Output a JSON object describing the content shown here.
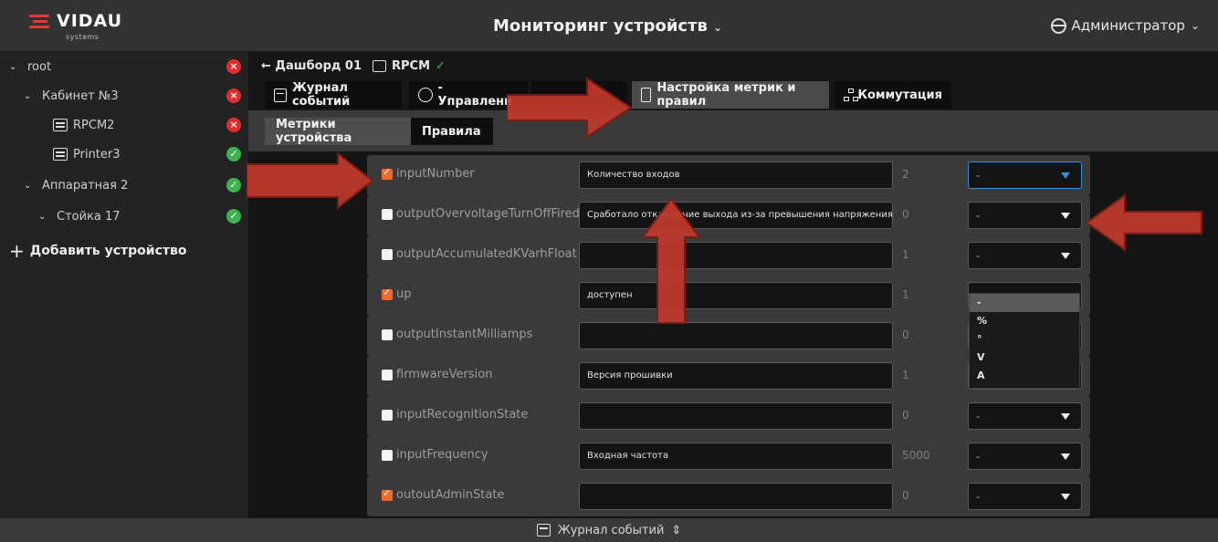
{
  "header": {
    "logo_text": "VIDAU",
    "logo_sub": "systems",
    "title": "Мониторинг устройств",
    "user": "Администратор"
  },
  "sidebar": {
    "items": [
      {
        "label": "root",
        "status": "error"
      },
      {
        "label": "Кабинет №3",
        "status": "error"
      },
      {
        "label": "RPCM2",
        "status": "error"
      },
      {
        "label": "Printer3",
        "status": "ok"
      },
      {
        "label": "Аппаратная 2",
        "status": "ok"
      },
      {
        "label": "Стойка 17",
        "status": "ok"
      }
    ],
    "add_device": "Добавить устройство"
  },
  "breadcrumb": {
    "back": "← Дашборд 01",
    "device": "RPCM"
  },
  "tabs": [
    {
      "label": "Журнал событий"
    },
    {
      "label": "- Управлени"
    },
    {
      "label": "Настройка метрик и правил"
    },
    {
      "label": "Коммутация"
    }
  ],
  "subtabs": [
    {
      "label": "Метрики устройства"
    },
    {
      "label": "Правила"
    }
  ],
  "rows": [
    {
      "metric": "inputNumber",
      "checked": true,
      "desc": "Количество входов",
      "num": "2",
      "unit": "-"
    },
    {
      "metric": "outputOvervoltageTurnOffFiredSt",
      "checked": false,
      "desc": "Сработало отключение выхода из-за превышения напряжения",
      "num": "0",
      "unit": "-"
    },
    {
      "metric": "outputAccumulatedKVarhFloat",
      "checked": false,
      "desc": "",
      "num": "1",
      "unit": "-"
    },
    {
      "metric": "up",
      "checked": true,
      "desc": "доступен",
      "num": "1",
      "unit": "-"
    },
    {
      "metric": "outputInstantMilliamps",
      "checked": false,
      "desc": "",
      "num": "0",
      "unit": "-"
    },
    {
      "metric": "firmwareVersion",
      "checked": false,
      "desc": "Версия прошивки",
      "num": "1",
      "unit": "-"
    },
    {
      "metric": "inputRecognitionState",
      "checked": false,
      "desc": "",
      "num": "0",
      "unit": "-"
    },
    {
      "metric": "inputFrequency",
      "checked": false,
      "desc": "Входная частота",
      "num": "5000",
      "unit": "-"
    },
    {
      "metric": "outoutAdminState",
      "checked": true,
      "desc": "",
      "num": "0",
      "unit": "-"
    }
  ],
  "dropdown_options": [
    "-",
    "%",
    "°",
    "V",
    "A"
  ],
  "footer": {
    "label": "Журнал событий"
  }
}
